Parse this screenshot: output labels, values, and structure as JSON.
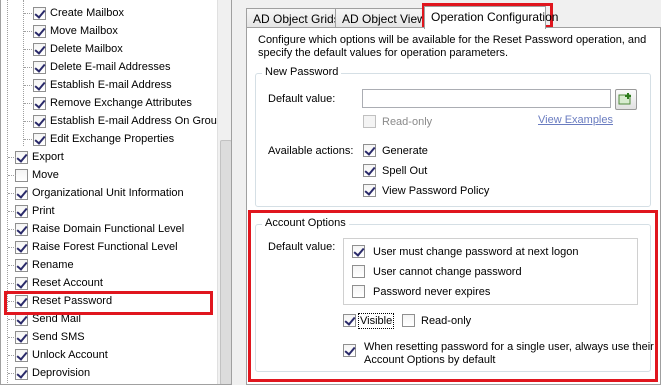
{
  "tree": {
    "items": [
      {
        "label": "Create Mailbox",
        "checked": true,
        "indent": 1
      },
      {
        "label": "Move Mailbox",
        "checked": true,
        "indent": 1
      },
      {
        "label": "Delete Mailbox",
        "checked": true,
        "indent": 1
      },
      {
        "label": "Delete E-mail Addresses",
        "checked": true,
        "indent": 1
      },
      {
        "label": "Establish E-mail Address",
        "checked": true,
        "indent": 1
      },
      {
        "label": "Remove Exchange Attributes",
        "checked": true,
        "indent": 1
      },
      {
        "label": "Establish E-mail Address On Group",
        "checked": true,
        "indent": 1
      },
      {
        "label": "Edit Exchange Properties",
        "checked": true,
        "indent": 1
      },
      {
        "label": "Export",
        "checked": true,
        "indent": 0
      },
      {
        "label": "Move",
        "checked": false,
        "indent": 0
      },
      {
        "label": "Organizational Unit Information",
        "checked": true,
        "indent": 0
      },
      {
        "label": "Print",
        "checked": true,
        "indent": 0
      },
      {
        "label": "Raise Domain Functional Level",
        "checked": true,
        "indent": 0
      },
      {
        "label": "Raise Forest Functional Level",
        "checked": true,
        "indent": 0
      },
      {
        "label": "Rename",
        "checked": true,
        "indent": 0
      },
      {
        "label": "Reset Account",
        "checked": true,
        "indent": 0
      },
      {
        "label": "Reset Password",
        "checked": true,
        "indent": 0
      },
      {
        "label": "Send Mail",
        "checked": true,
        "indent": 0
      },
      {
        "label": "Send SMS",
        "checked": true,
        "indent": 0
      },
      {
        "label": "Unlock Account",
        "checked": true,
        "indent": 0
      },
      {
        "label": "Deprovision",
        "checked": true,
        "indent": 0
      }
    ]
  },
  "tabs": [
    {
      "label": "AD Object Grids",
      "active": false
    },
    {
      "label": "AD Object Views",
      "active": false
    },
    {
      "label": "Operation Configuration",
      "active": true
    }
  ],
  "intro": "Configure which options will be available for the Reset Password operation, and specify the default values for operation parameters.",
  "new_password": {
    "title": "New Password",
    "default_label": "Default value:",
    "default_value": "",
    "readonly_label": "Read-only",
    "readonly_checked": false,
    "view_examples": "View Examples",
    "actions_label": "Available actions:",
    "actions": [
      {
        "label": "Generate",
        "checked": true
      },
      {
        "label": "Spell Out",
        "checked": true
      },
      {
        "label": "View Password Policy",
        "checked": true
      }
    ]
  },
  "account_options": {
    "title": "Account Options",
    "default_label": "Default value:",
    "options": [
      {
        "label": "User must change password at next logon",
        "checked": true
      },
      {
        "label": "User cannot change password",
        "checked": false
      },
      {
        "label": "Password never expires",
        "checked": false
      }
    ],
    "visible_label": "Visible",
    "visible_checked": true,
    "readonly_label": "Read-only",
    "readonly_checked": false,
    "single_user_label_1": "When resetting password for a single user, always use their",
    "single_user_label_2": "Account Options by default",
    "single_user_checked": true
  },
  "colors": {
    "highlight": "#e0161e",
    "link": "#6a7cc0",
    "check": "#2a2a6a"
  }
}
